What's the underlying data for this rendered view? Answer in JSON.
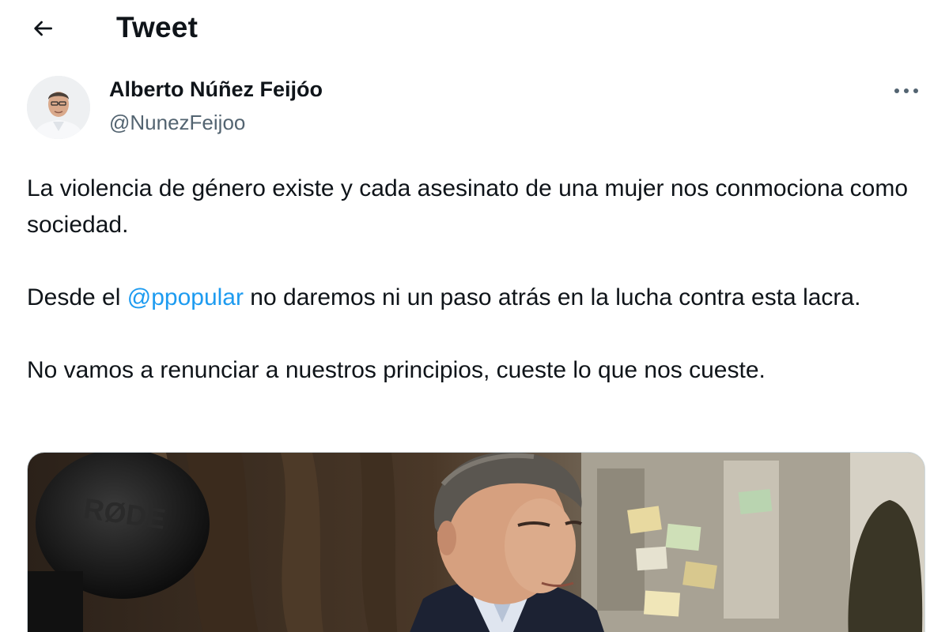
{
  "header": {
    "title": "Tweet",
    "back_icon": "arrow-left-icon"
  },
  "author": {
    "name": "Alberto Núñez Feijóo",
    "handle": "@NunezFeijoo",
    "more_icon": "ellipsis-icon"
  },
  "tweet": {
    "paragraph1": "La violencia de género existe y cada asesinato de una mujer nos conmociona como sociedad.",
    "paragraph2_prefix": "Desde el ",
    "paragraph2_mention": "@ppopular",
    "paragraph2_suffix": " no daremos ni un paso atrás en la lucha contra esta lacra.",
    "paragraph3": "No vamos a renunciar a nuestros principios, cueste lo que nos cueste."
  },
  "colors": {
    "text": "#0f1419",
    "secondary": "#536471",
    "link": "#1d9bf0",
    "border": "#cfd9de"
  },
  "media": {
    "microphone_logo": "RØDE"
  }
}
